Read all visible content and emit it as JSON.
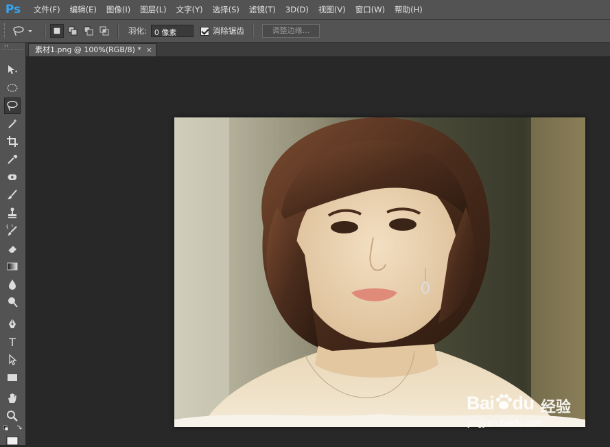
{
  "app": {
    "logo": "Ps"
  },
  "menu": [
    "文件(F)",
    "编辑(E)",
    "图像(I)",
    "图层(L)",
    "文字(Y)",
    "选择(S)",
    "滤镜(T)",
    "3D(D)",
    "视图(V)",
    "窗口(W)",
    "帮助(H)"
  ],
  "options": {
    "feather_label": "羽化:",
    "feather_value": "0 像素",
    "antialias_label": "消除锯齿",
    "antialias_checked": true,
    "refine_edge_label": "调整边缘..."
  },
  "toolbox": {
    "header": "››",
    "tools": [
      "move-tool",
      "marquee-tool",
      "lasso-tool",
      "magic-wand-tool",
      "crop-tool",
      "eyedropper-tool",
      "healing-tool",
      "brush-tool",
      "stamp-tool",
      "history-brush-tool",
      "eraser-tool",
      "gradient-tool",
      "blur-tool",
      "dodge-tool",
      "pen-tool",
      "type-tool",
      "path-select-tool",
      "shape-tool",
      "hand-tool",
      "zoom-tool"
    ],
    "type_glyph": "T",
    "active_tool": "lasso-tool"
  },
  "document": {
    "tab_title": "素材1.png @ 100%(RGB/8) *",
    "tab_close": "×"
  },
  "watermark": {
    "brand": "Bai",
    "brand_suffix": "du",
    "cn": "经验",
    "url": "jingyan.baidu.com"
  },
  "colors": {
    "ui_bg": "#535353",
    "canvas_bg": "#282828",
    "ps_blue": "#33a6f4"
  }
}
